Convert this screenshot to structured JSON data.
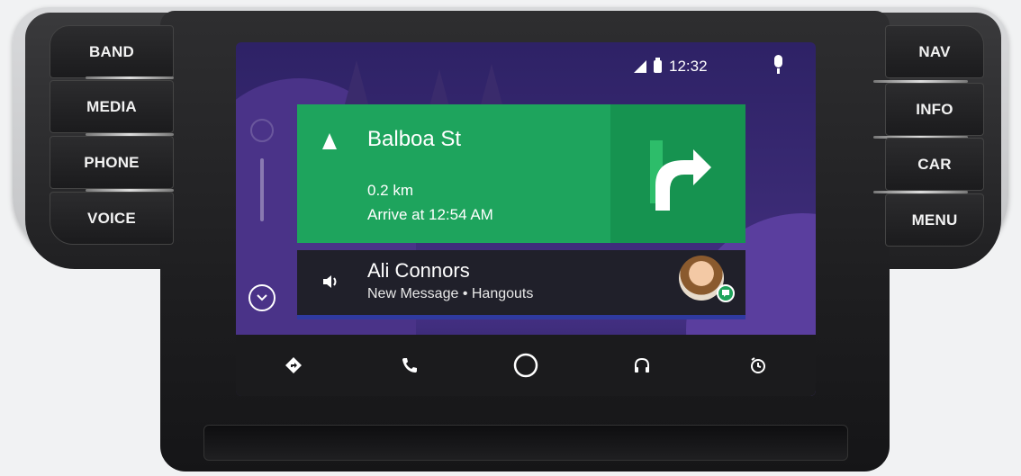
{
  "hardware_buttons": {
    "left": [
      "BAND",
      "MEDIA",
      "PHONE",
      "VOICE"
    ],
    "right": [
      "NAV",
      "INFO",
      "CAR",
      "MENU"
    ]
  },
  "status_bar": {
    "time": "12:32",
    "icons": [
      "signal-icon",
      "battery-icon",
      "mic-icon"
    ]
  },
  "navigation_card": {
    "street": "Balboa St",
    "distance": "0.2 km",
    "arrival": "Arrive at 12:54 AM",
    "maneuver_icon": "turn-right-arrow-icon",
    "color": "#1ea45d"
  },
  "notification_card": {
    "name": "Ali Connors",
    "subtitle": "New Message • Hangouts",
    "icon": "speaker-icon",
    "badge": "hangouts-icon"
  },
  "bottom_bar": {
    "items": [
      "navigation-icon",
      "phone-icon",
      "home-icon",
      "headphones-icon",
      "recent-icon"
    ]
  }
}
